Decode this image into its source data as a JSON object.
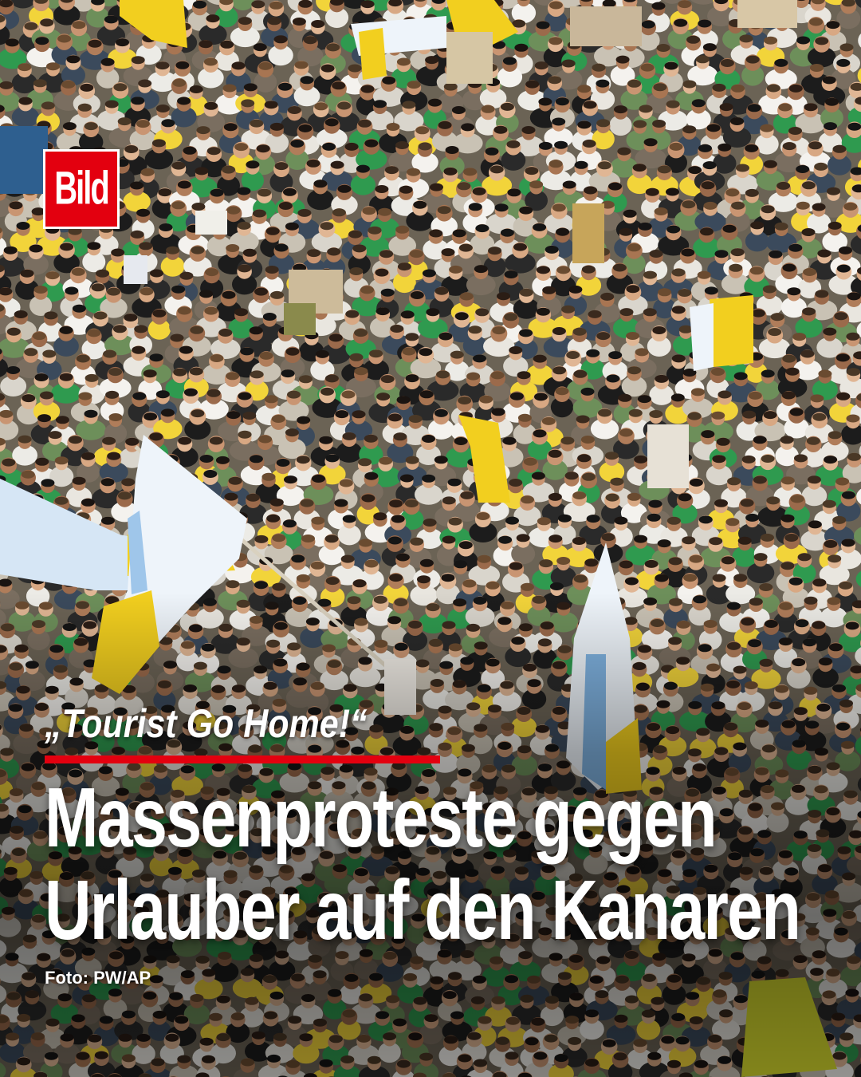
{
  "brand": {
    "logo_text": "Bild",
    "accent_color": "#e3000f"
  },
  "article": {
    "kicker": "„Tourist Go Home!“",
    "headline_line1": "Massenproteste gegen",
    "headline_line2": "Urlauber auf den Kanaren",
    "photo_credit": "Foto: PW/AP"
  }
}
